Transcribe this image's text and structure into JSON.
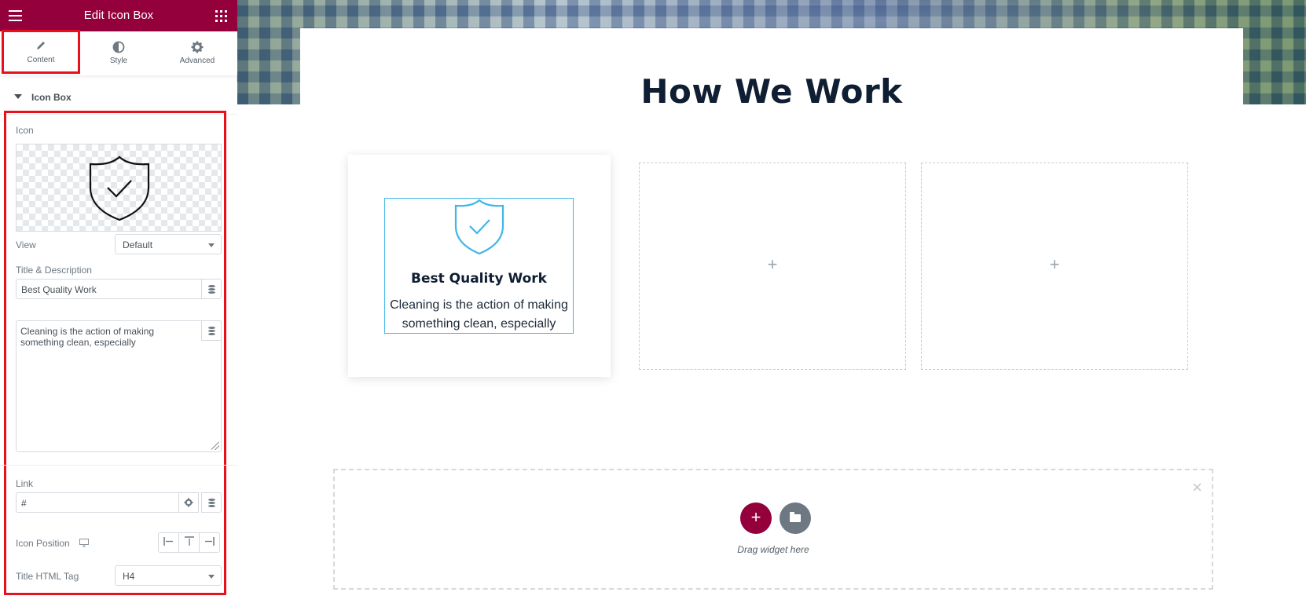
{
  "panel": {
    "title": "Edit Icon Box",
    "tabs": [
      {
        "label": "Content",
        "icon": "pencil-icon"
      },
      {
        "label": "Style",
        "icon": "half-circle-icon"
      },
      {
        "label": "Advanced",
        "icon": "gear-icon"
      }
    ],
    "section": "Icon Box",
    "controls": {
      "icon_label": "Icon",
      "view_label": "View",
      "view_value": "Default",
      "title_desc_label": "Title & Description",
      "title_value": "Best Quality Work",
      "description_value": "Cleaning is the action of making something clean, especially",
      "link_label": "Link",
      "link_value": "#",
      "icon_position_label": "Icon Position",
      "title_tag_label": "Title HTML Tag",
      "title_tag_value": "H4"
    }
  },
  "canvas": {
    "heading": "How We Work",
    "icon_box": {
      "title": "Best Quality Work",
      "description": "Cleaning is the action of making something clean, especially"
    },
    "empty_plus": "+",
    "drop_zone": {
      "add": "+",
      "close": "×",
      "text": "Drag widget here"
    }
  },
  "colors": {
    "brand": "#93003c",
    "highlight": "#e8101a",
    "icon_accent": "#41b6e6",
    "heading": "#0f1e33"
  }
}
